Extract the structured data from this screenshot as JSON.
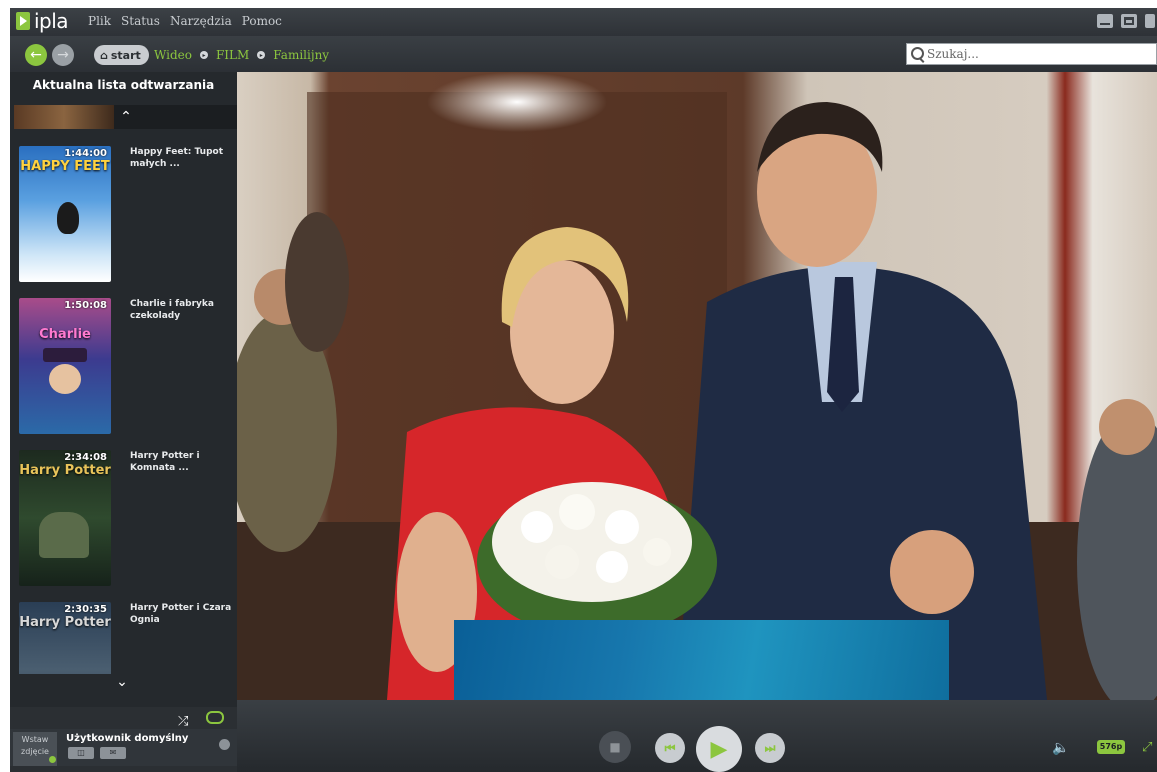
{
  "app": {
    "logo": "ipla"
  },
  "menu": [
    "Plik",
    "Status",
    "Narzędzia",
    "Pomoc"
  ],
  "nav": {
    "start_label": "start",
    "breadcrumb": [
      "Wideo",
      "FILM",
      "Familijny"
    ],
    "search_placeholder": "Szukaj..."
  },
  "playlist": {
    "title": "Aktualna lista odtwarzania",
    "items": [
      {
        "title": "Happy Feet: Tupot małych ...",
        "duration": "1:44:00",
        "poster_text": "HAPPY FEET"
      },
      {
        "title": "Charlie i fabryka czekolady",
        "duration": "1:50:08",
        "poster_text": "Charlie"
      },
      {
        "title": "Harry Potter i Komnata ...",
        "duration": "2:34:08",
        "poster_text": "Harry Potter"
      },
      {
        "title": "Harry Potter i Czara Ognia",
        "duration": "2:30:35",
        "poster_text": "Harry Potter"
      }
    ]
  },
  "user": {
    "avatar_label": "Wstaw zdjęcie",
    "name": "Użytkownik domyślny"
  },
  "player": {
    "quality": "576p"
  },
  "colors": {
    "accent": "#8cc63f",
    "background": "#2b2f33",
    "sidebar": "#25292d"
  }
}
